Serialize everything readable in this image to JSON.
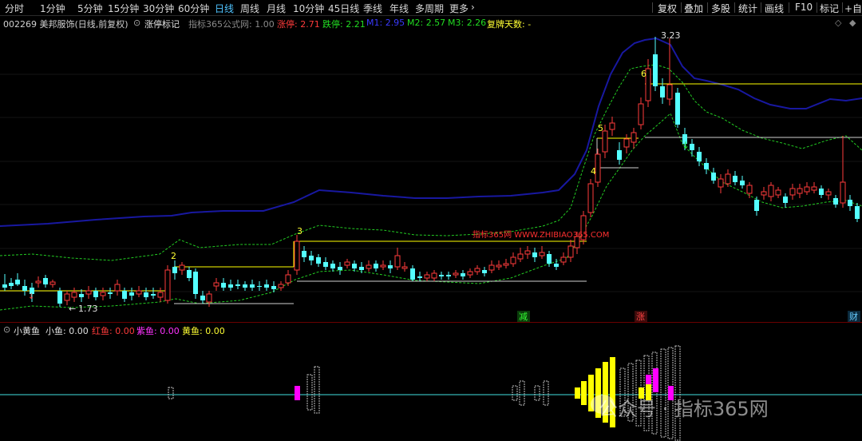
{
  "toolbar": {
    "periods": [
      "分时",
      "1分钟",
      "5分钟",
      "15分钟",
      "30分钟",
      "60分钟",
      "日线",
      "周线",
      "月线",
      "10分钟",
      "45日线",
      "季线",
      "年线",
      "多周期",
      "更多"
    ],
    "active_period": "日线",
    "tools": [
      "复权",
      "叠加",
      "多股",
      "统计",
      "画线",
      "F10",
      "标记",
      "+自选"
    ]
  },
  "info": {
    "code_name": "002269 美邦服饰(日线,前复权)",
    "indicator": "涨停标记",
    "formula": "指标365公式网: 1.00",
    "zt_label": "涨停: 2.71",
    "dt_label": "跌停: 2.21",
    "m1_label": "M1: 2.95",
    "m2_label": "M2: 2.57",
    "m3_label": "M3: 2.26",
    "fupai_label": "复牌天数: -"
  },
  "main": {
    "high_label": "3.23",
    "low_label": "1.73",
    "count_labels": [
      "2",
      "3",
      "4",
      "5",
      "6"
    ],
    "watermark": "指标365网 WWW.ZHIBIAO365.COM",
    "bottom_tags": [
      "减",
      "涨",
      "财"
    ]
  },
  "sub": {
    "name": "小黄鱼",
    "xiaoyu": "小鱼: 0.00",
    "hongyu": "红鱼: 0.00",
    "ziyu": "紫鱼: 0.00",
    "huangyu": "黄鱼: 0.00"
  },
  "overlay": {
    "wechat_watermark": "公众号 · 指标365网"
  },
  "colors": {
    "up": "#ff3b3b",
    "down": "#54ffff",
    "line": "#40e0e0",
    "yellow": "#ffff00",
    "magenta": "#ff00ff",
    "navy": "#1818a0",
    "green_dash": "#22cc22"
  }
}
